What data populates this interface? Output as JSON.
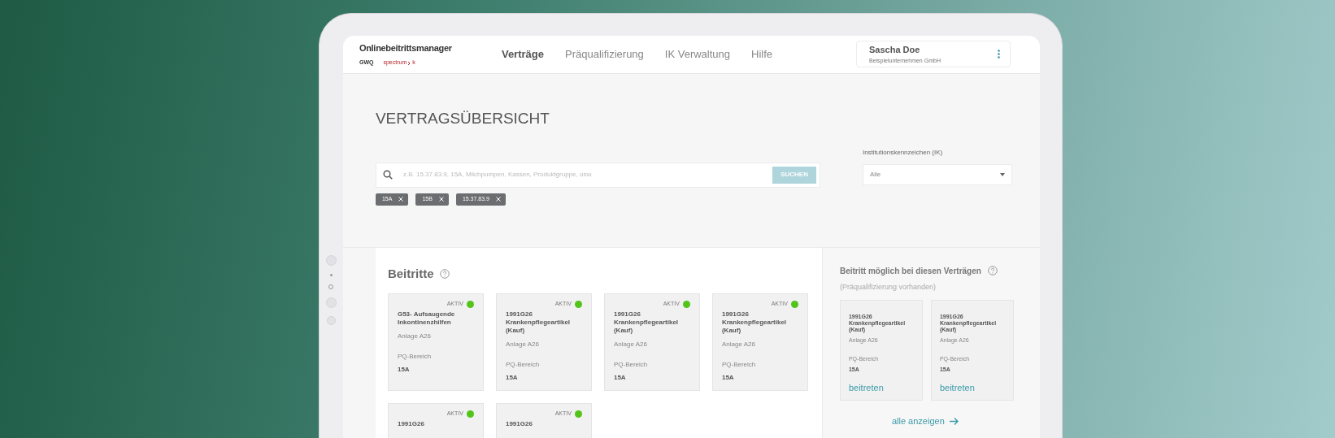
{
  "header": {
    "app_name": "Onlinebeitrittsmanager",
    "logos": [
      "GWQ",
      "spectrum",
      "k"
    ],
    "nav": [
      {
        "label": "Verträge",
        "selected": true
      },
      {
        "label": "Präqualifizierung",
        "selected": false
      },
      {
        "label": "IK Verwaltung",
        "selected": false
      },
      {
        "label": "Hilfe",
        "selected": false
      }
    ],
    "user": {
      "name": "Sascha Doe",
      "company": "Beispielunternehmen GmbH"
    }
  },
  "page_title": "VERTRAGSÜBERSICHT",
  "search": {
    "placeholder": "z.B. 15.37.83.9, 15A, Milchpumpen, Kassen, Produktgruppe, usw.",
    "button": "SUCHEN"
  },
  "filters": [
    "15A",
    "15B",
    "15.37.83.9"
  ],
  "ik_select": {
    "label": "Institutionskennzeichen (IK)",
    "value": "Alle"
  },
  "beitritte": {
    "title": "Beitritte",
    "cards": [
      {
        "status": "AKTIV",
        "color": "#52c41a",
        "title": "G53- Aufsaugende Inkontinenzhilfen",
        "anlage": "Anlage A26",
        "pq_label": "PQ-Bereich",
        "pq": "15A"
      },
      {
        "status": "AKTIV",
        "color": "#52c41a",
        "title": "1991G26 Krankenpflegeartikel (Kauf)",
        "anlage": "Anlage A26",
        "pq_label": "PQ-Bereich",
        "pq": "15A"
      },
      {
        "status": "AKTIV",
        "color": "#52c41a",
        "title": "1991G26 Krankenpflegeartikel (Kauf)",
        "anlage": "Anlage A26",
        "pq_label": "PQ-Bereich",
        "pq": "15A"
      },
      {
        "status": "AKTIV",
        "color": "#52c41a",
        "title": "1991G26 Krankenpflegeartikel (Kauf)",
        "anlage": "Anlage A26",
        "pq_label": "PQ-Bereich",
        "pq": "15A"
      },
      {
        "status": "AKTIV",
        "color": "#52c41a",
        "title": "1991G26"
      },
      {
        "status": "AKTIV",
        "color": "#52c41a",
        "title": "1991G26"
      }
    ]
  },
  "possible": {
    "title": "Beitritt möglich bei diesen Verträgen",
    "subtitle": "(Präqualifizierung vorhanden)",
    "cards": [
      {
        "title": "1991G26 Krankenpflegeartikel (Kauf)",
        "anlage": "Anlage A26",
        "pq_label": "PQ-Bereich",
        "pq": "15A",
        "action": "beitreten"
      },
      {
        "title": "1991G26 Krankenpflegeartikel (Kauf)",
        "anlage": "Anlage A26",
        "pq_label": "PQ-Bereich",
        "pq": "15A",
        "action": "beitreten"
      }
    ],
    "show_all": "alle anzeigen"
  }
}
